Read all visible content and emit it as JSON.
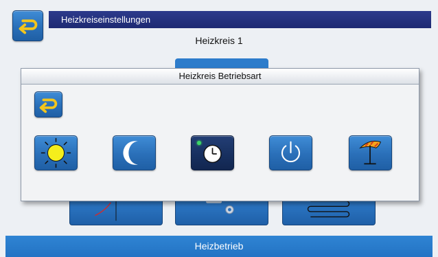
{
  "header": {
    "title": "Heizkreiseinstellungen"
  },
  "subtitle": "Heizkreis 1",
  "dialog": {
    "title": "Heizkreis Betriebsart",
    "modes": [
      {
        "name": "sun-icon",
        "label": ""
      },
      {
        "name": "moon-icon",
        "label": ""
      },
      {
        "name": "clock-icon",
        "label": "",
        "active": true
      },
      {
        "name": "power-icon",
        "label": ""
      },
      {
        "name": "umbrella-icon",
        "label": ""
      }
    ]
  },
  "footer": {
    "label": "Heizbetrieb"
  },
  "colors": {
    "accent": "#2a6fb8",
    "selected": "#172f5e",
    "header": "#1e2a73",
    "sun": "#f5ee1c",
    "active_dot": "#3cd66a"
  }
}
